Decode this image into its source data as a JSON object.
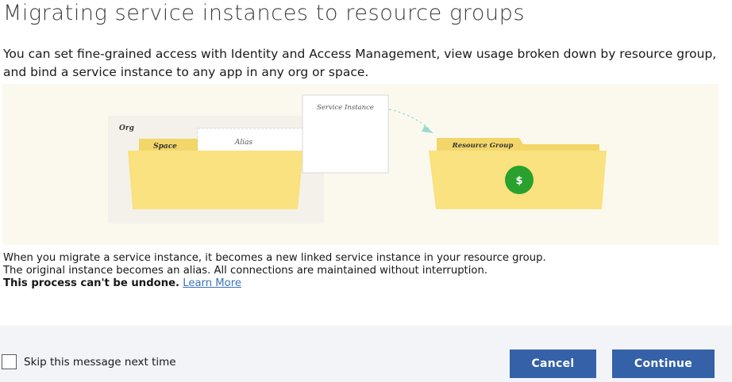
{
  "dialog": {
    "title": "Migrating service instances to resource groups",
    "intro": "You can set fine-grained access with Identity and Access Management, view usage broken down by resource group, and bind a service instance to any app in any org or space.",
    "illustration": {
      "org_label": "Org",
      "space_label": "Space",
      "alias_label": "Alias",
      "service_instance_label": "Service Instance",
      "resource_group_label": "Resource Group",
      "dollar_icon": "$"
    },
    "description_line1": "When you migrate a service instance, it becomes a new linked service instance in your resource group.",
    "description_line2": "The original instance becomes an alias. All connections are maintained without interruption.",
    "warning": "This process can't be undone.",
    "learn_more": "Learn More"
  },
  "footer": {
    "checkbox_label": "Skip this message next time",
    "checkbox_checked": false,
    "cancel_label": "Cancel",
    "continue_label": "Continue"
  },
  "colors": {
    "primary_button": "#3461a8",
    "folder": "#f9e27f",
    "folder_tab": "#f3d66a",
    "dollar_circle": "#2aa12e",
    "link": "#3b73b9"
  }
}
